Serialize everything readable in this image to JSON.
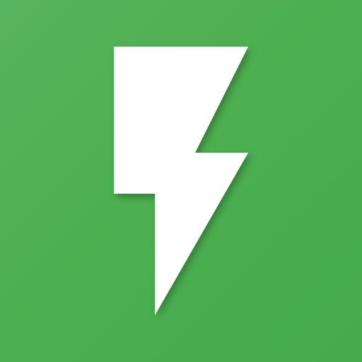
{
  "icon": {
    "name": "lightning-bolt-icon",
    "background_color": "#4caf50",
    "foreground_color": "#ffffff"
  }
}
